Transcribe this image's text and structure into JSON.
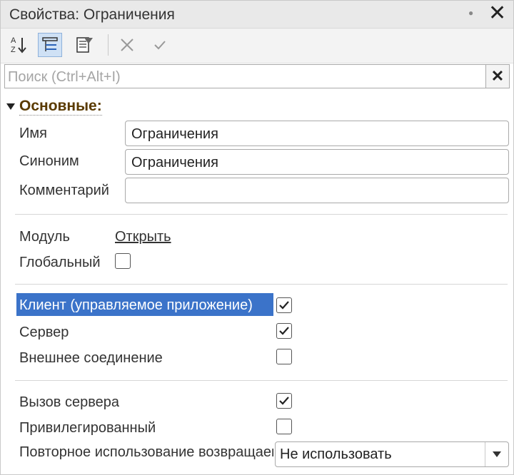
{
  "window": {
    "title": "Свойства: Ограничения"
  },
  "search": {
    "placeholder": "Поиск (Ctrl+Alt+I)"
  },
  "group": {
    "title": "Основные:"
  },
  "fields": {
    "name_label": "Имя",
    "name_value": "Ограничения",
    "synonym_label": "Синоним",
    "synonym_value": "Ограничения",
    "comment_label": "Комментарий",
    "comment_value": ""
  },
  "module": {
    "label": "Модуль",
    "link": "Открыть"
  },
  "global": {
    "label": "Глобальный",
    "checked": false
  },
  "flags": {
    "client_label": "Клиент (управляемое приложение)",
    "client_checked": true,
    "server_label": "Сервер",
    "server_checked": true,
    "external_label": "Внешнее соединение",
    "external_checked": false
  },
  "call": {
    "server_call_label": "Вызов сервера",
    "server_call_checked": true,
    "privileged_label": "Привилегированный",
    "privileged_checked": false,
    "reuse_label": "Повторное использование возвращаемых значений",
    "reuse_value": "Не использовать"
  },
  "icons": {
    "sort": "sort-az-icon",
    "categories": "categories-icon",
    "filter": "filter-icon",
    "cancel": "cancel-icon",
    "apply": "apply-icon",
    "pin": "pin-icon",
    "close": "close-icon"
  },
  "colors": {
    "selection": "#3b73c9",
    "group_title": "#5a3a00"
  }
}
